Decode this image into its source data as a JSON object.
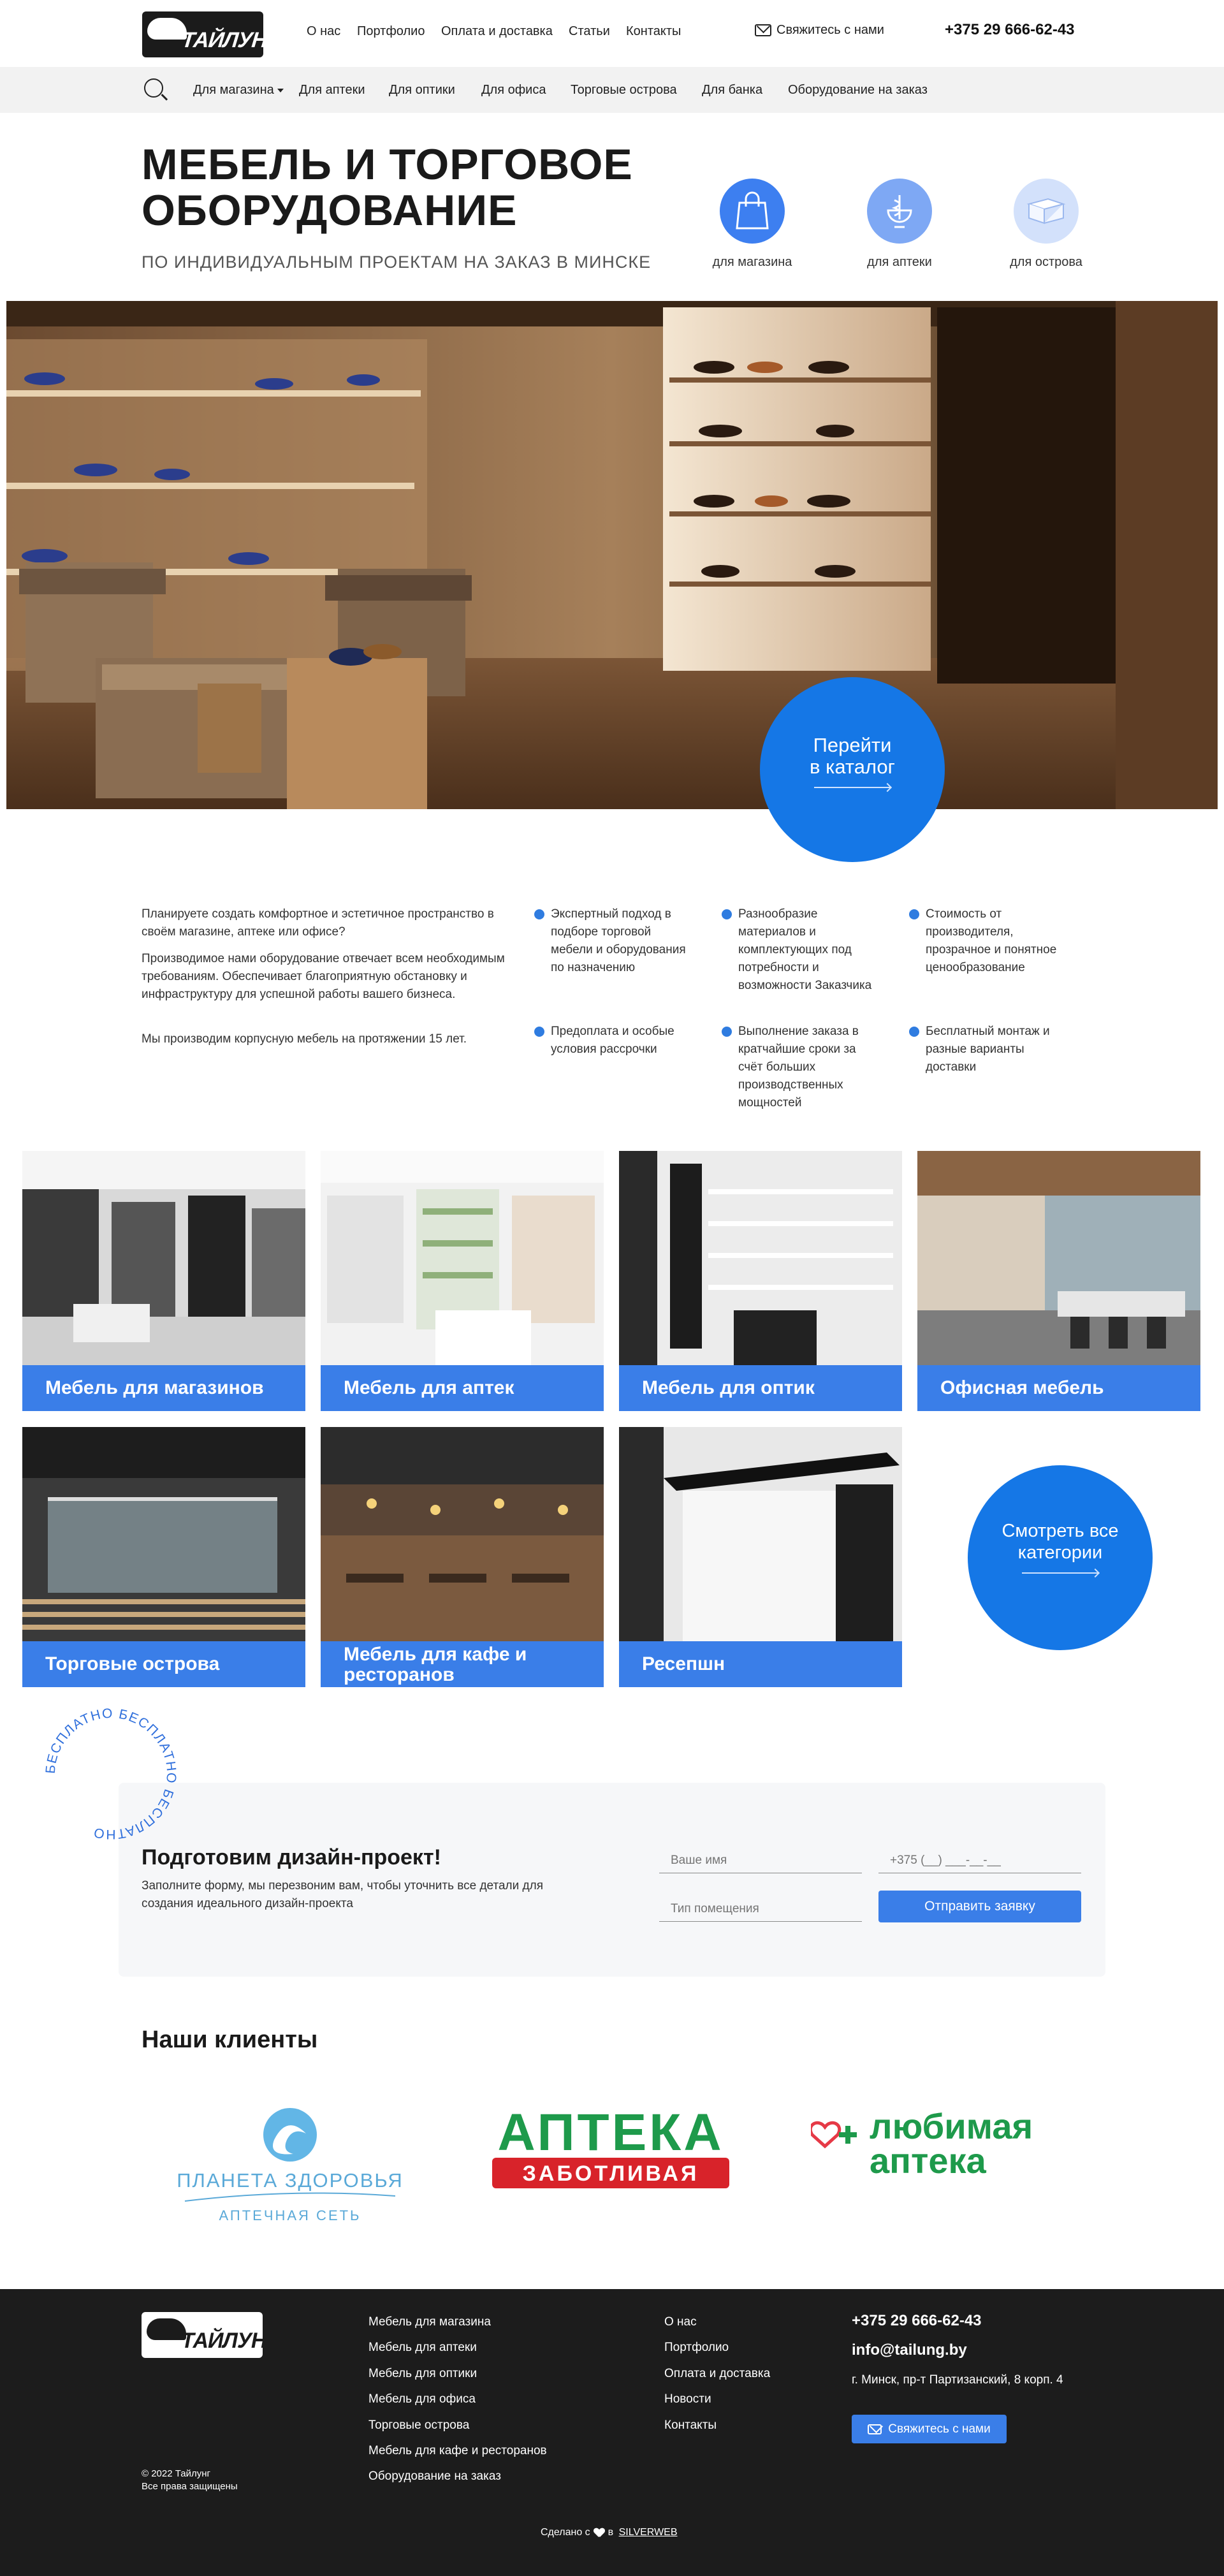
{
  "header": {
    "logo_text": "ТАЙЛУНГ",
    "nav": [
      "О нас",
      "Портфолио",
      "Оплата и доставка",
      "Статьи",
      "Контакты"
    ],
    "contact_label": "Свяжитесь с нами",
    "phone": "+375 29 666-62-43"
  },
  "subnav": {
    "items": [
      "Для магазина",
      "Для аптеки",
      "Для оптики",
      "Для офиса",
      "Торговые острова",
      "Для банка",
      "Оборудование на заказ"
    ]
  },
  "hero": {
    "title_line1": "МЕБЕЛЬ И ТОРГОВОЕ",
    "title_line2": "ОБОРУДОВАНИЕ",
    "subtitle": "ПО ИНДИВИДУАЛЬНЫМ ПРОЕКТАМ НА ЗАКАЗ В МИНСКЕ",
    "categories": [
      {
        "label": "для магазина",
        "icon": "shopping-bag-icon",
        "color": "#3d7ff0"
      },
      {
        "label": "для аптеки",
        "icon": "pharmacy-bowl-icon",
        "color": "#7ea8f4"
      },
      {
        "label": "для острова",
        "icon": "island-counter-icon",
        "color": "#d3e1fb"
      }
    ],
    "catalog_button_line1": "Перейти",
    "catalog_button_line2": "в каталог"
  },
  "intro": {
    "paragraphs": [
      "Планируете создать комфортное и эстетичное пространство в своём магазине, аптеке или офисе?",
      "Производимое нами оборудование отвечает всем необходимым требованиям. Обеспечивает благоприятную обстановку и инфраструктуру для успешной работы вашего бизнеса.",
      "Мы производим корпусную мебель на протяжении 15 лет."
    ],
    "features": [
      "Экспертный подход в подборе торговой мебели и оборудования по назначению",
      "Разнообразие материалов и комплектующих под потребности и возможности Заказчика",
      "Стоимость от производителя, прозрачное и понятное ценообразование",
      "Предоплата и особые условия рассрочки",
      "Выполнение заказа в кратчайшие сроки за счёт больших производственных мощностей",
      "Бесплатный монтаж и разные варианты доставки"
    ],
    "bullet_color": "#2f7ce0"
  },
  "categories": {
    "tiles": [
      {
        "label": "Мебель для магазинов"
      },
      {
        "label": "Мебель для аптек"
      },
      {
        "label": "Мебель для оптик"
      },
      {
        "label": "Офисная мебель"
      },
      {
        "label": "Торговые острова"
      },
      {
        "label": "Мебель для кафе и ресторанов"
      },
      {
        "label": "Ресепшн"
      }
    ],
    "all_button_line1": "Смотреть все",
    "all_button_line2": "категории"
  },
  "form": {
    "badge_text": "БЕСПЛАТНО БЕСПЛАТНО БЕСПЛАТНО",
    "title": "Подготовим дизайн-проект!",
    "description": "Заполните форму, мы перезвоним вам, чтобы уточнить все детали для создания идеального дизайн-проекта",
    "name_placeholder": "Ваше имя",
    "phone_placeholder": "+375 (__) ___-__-__",
    "room_placeholder": "Тип помещения",
    "submit_label": "Отправить заявку"
  },
  "clients": {
    "title": "Наши клиенты",
    "logos": [
      {
        "line1": "ПЛАНЕТА ЗДОРОВЬЯ",
        "line2": "АПТЕЧНАЯ СЕТЬ"
      },
      {
        "line1": "АПТЕКА",
        "line2": "ЗАБОТЛИВАЯ"
      },
      {
        "line1": "любимая",
        "line2": "аптека"
      }
    ]
  },
  "footer": {
    "logo_text": "ТАЙЛУНГ",
    "copyright": "© 2022 Тайлунг",
    "rights": "Все права защищены",
    "col1": [
      "Мебель для магазина",
      "Мебель для аптеки",
      "Мебель для оптики",
      "Мебель для офиса",
      "Торговые острова",
      "Мебель для кафе и ресторанов",
      "Оборудование на заказ"
    ],
    "col2": [
      "О нас",
      "Портфолио",
      "Оплата и доставка",
      "Новости",
      "Контакты"
    ],
    "phone": "+375 29 666-62-43",
    "email": "info@tailung.by",
    "address": "г. Минск, пр-т Партизанский, 8 корп. 4",
    "contact_button": "Свяжитесь с нами",
    "made_with": "Сделано с",
    "made_in": "в",
    "agency": "SILVERWEB"
  }
}
